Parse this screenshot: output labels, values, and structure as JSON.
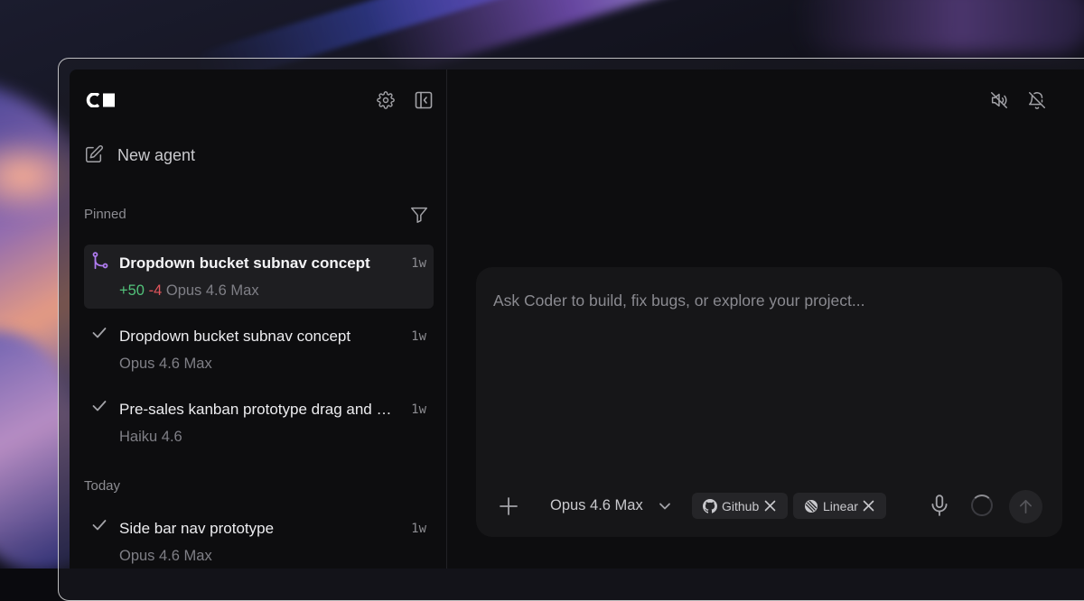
{
  "sidebar": {
    "logo_icon": "coder-logo-icon",
    "settings_icon": "gear-icon",
    "collapse_icon": "sidebar-collapse-icon",
    "new_agent": {
      "icon": "pencil-square-icon",
      "label": "New agent"
    },
    "filter_icon": "funnel-icon",
    "sections": {
      "pinned": {
        "label": "Pinned",
        "items": [
          {
            "icon": "git-branch-icon",
            "title": "Dropdown bucket subnav concept",
            "time": "1w",
            "additions": "+50",
            "deletions": "-4",
            "model": "Opus 4.6 Max",
            "active": true
          },
          {
            "icon": "check-icon",
            "title": "Dropdown bucket subnav concept",
            "time": "1w",
            "model": "Opus 4.6 Max"
          },
          {
            "icon": "check-icon",
            "title": "Pre-sales kanban prototype drag and drop",
            "time": "1w",
            "model": "Haiku 4.6"
          }
        ]
      },
      "today": {
        "label": "Today",
        "items": [
          {
            "icon": "check-icon",
            "title": "Side bar nav prototype",
            "time": "1w",
            "model": "Opus 4.6 Max"
          }
        ]
      }
    }
  },
  "header": {
    "mute_icon": "volume-off-icon",
    "notifications_icon": "bell-off-icon"
  },
  "composer": {
    "placeholder": "Ask Coder to build, fix bugs, or explore your project...",
    "value": "",
    "add_icon": "plus-icon",
    "model": {
      "label": "Opus 4.6 Max",
      "icon": "chevron-down-icon"
    },
    "integrations": [
      {
        "label": "Github",
        "icon": "github-icon",
        "close_icon": "close-icon"
      },
      {
        "label": "Linear",
        "icon": "linear-icon",
        "close_icon": "close-icon"
      }
    ],
    "mic_icon": "microphone-icon",
    "status_icon": "spinner-icon",
    "send_icon": "arrow-up-icon"
  }
}
